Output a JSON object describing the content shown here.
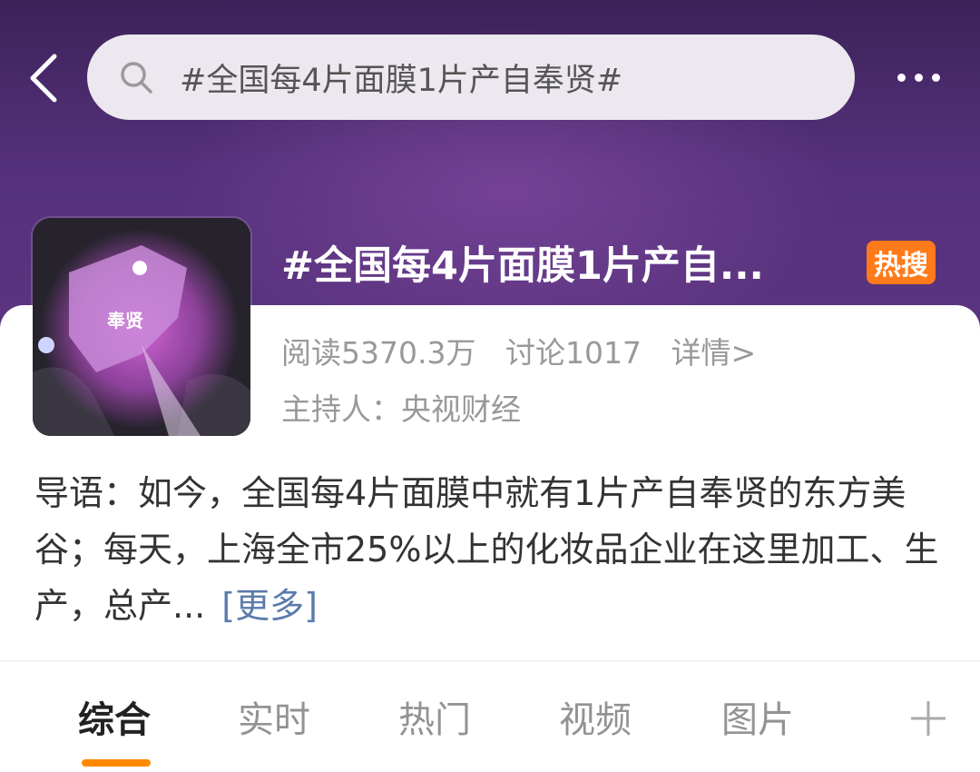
{
  "search": {
    "query": "#全国每4片面膜1片产自奉贤#"
  },
  "topic": {
    "title": "#全国每4片面膜1片产自...",
    "badge": "热搜",
    "reads": "阅读5370.3万",
    "discussions": "讨论1017",
    "details": "详情>",
    "host": "主持人：央视财经",
    "thumbnail_label": "奉贤"
  },
  "intro": {
    "text": "导语：如今，全国每4片面膜中就有1片产自奉贤的东方美谷；每天，上海全市25%以上的化妆品企业在这里加工、生产，总产...",
    "more": "[更多]"
  },
  "tabs": [
    {
      "label": "综合",
      "active": true
    },
    {
      "label": "实时",
      "active": false
    },
    {
      "label": "热门",
      "active": false
    },
    {
      "label": "视频",
      "active": false
    },
    {
      "label": "图片",
      "active": false
    }
  ],
  "colors": {
    "header_bg": "#55307a",
    "badge": "#ff7a1a",
    "tab_indicator": "#ff8a00",
    "link": "#5b7bab"
  },
  "icons": [
    "back-icon",
    "search-icon",
    "more-icon",
    "add-tab-icon"
  ]
}
